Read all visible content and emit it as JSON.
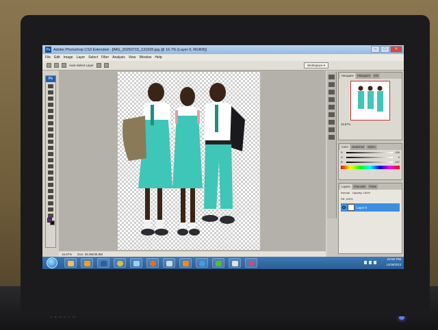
{
  "window": {
    "title": "Adobe Photoshop CS3 Extended - [IMG_20250715_131505.jpg @ 16.7% (Layer 0, RGB/8)]",
    "minimize": "–",
    "maximize": "□",
    "close": "×"
  },
  "menu": [
    "File",
    "Edit",
    "Image",
    "Layer",
    "Select",
    "Filter",
    "Analysis",
    "View",
    "Window",
    "Help"
  ],
  "options_bar": {
    "auto_select": "Auto-Select Layer",
    "workspace": "Workspace ▾"
  },
  "status": {
    "zoom": "16.67%",
    "doc": "Doc: 35.9M/35.9M"
  },
  "navigator": {
    "tabs": [
      "Navigator",
      "Histogram",
      "Info"
    ],
    "zoom": "16.67%"
  },
  "color_panel": {
    "tabs": [
      "Color",
      "Swatches",
      "Styles"
    ],
    "channels": [
      {
        "label": "R",
        "value": "255"
      },
      {
        "label": "G",
        "value": "0"
      },
      {
        "label": "B",
        "value": "157"
      }
    ]
  },
  "layers_panel": {
    "tabs": [
      "Layers",
      "Channels",
      "Paths"
    ],
    "blend_mode": "Normal",
    "opacity": "Opacity: 100%",
    "fill": "Fill: 100%",
    "layer_name": "Layer 0"
  },
  "taskbar": {
    "time": "10:52 PM",
    "date": "12/26/2013",
    "apps": [
      "explorer",
      "media-player",
      "photoshop",
      "chrome",
      "paint",
      "firefox",
      "calculator",
      "word"
    ]
  },
  "colors": {
    "uniform_teal": "#3ec6b8",
    "skin": "#4a2a1c",
    "photoshop_blue": "#2a5ea8",
    "taskbar_blue": "#2a5d96"
  },
  "base": {
    "brand": "LENOVO"
  }
}
